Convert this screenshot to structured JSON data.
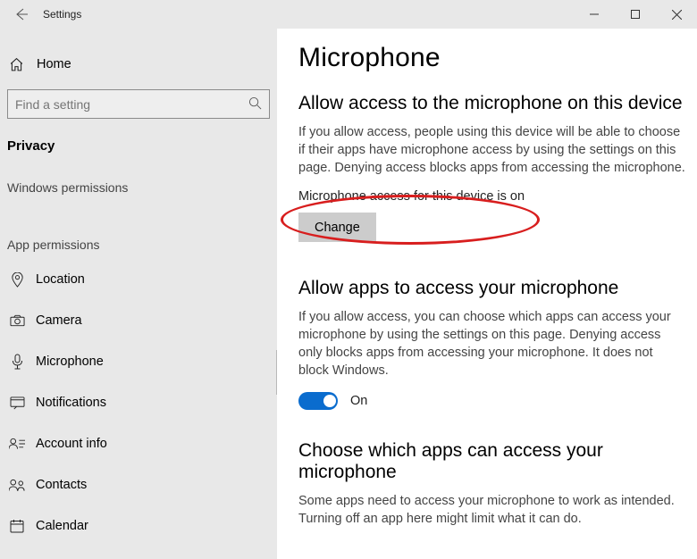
{
  "titlebar": {
    "title": "Settings"
  },
  "sidebar": {
    "home": "Home",
    "search_placeholder": "Find a setting",
    "section": "Privacy",
    "sub1": "Windows permissions",
    "sub2": "App permissions",
    "items": [
      {
        "label": "Location"
      },
      {
        "label": "Camera"
      },
      {
        "label": "Microphone"
      },
      {
        "label": "Notifications"
      },
      {
        "label": "Account info"
      },
      {
        "label": "Contacts"
      },
      {
        "label": "Calendar"
      }
    ]
  },
  "main": {
    "title": "Microphone",
    "section1": {
      "heading": "Allow access to the microphone on this device",
      "body": "If you allow access, people using this device will be able to choose if their apps have microphone access by using the settings on this page. Denying access blocks apps from accessing the microphone.",
      "status": "Microphone access for this device is on",
      "change": "Change"
    },
    "section2": {
      "heading": "Allow apps to access your microphone",
      "body": "If you allow access, you can choose which apps can access your microphone by using the settings on this page. Denying access only blocks apps from accessing your microphone. It does not block Windows.",
      "toggle_label": "On"
    },
    "section3": {
      "heading": "Choose which apps can access your microphone",
      "body": "Some apps need to access your microphone to work as intended. Turning off an app here might limit what it can do."
    }
  }
}
